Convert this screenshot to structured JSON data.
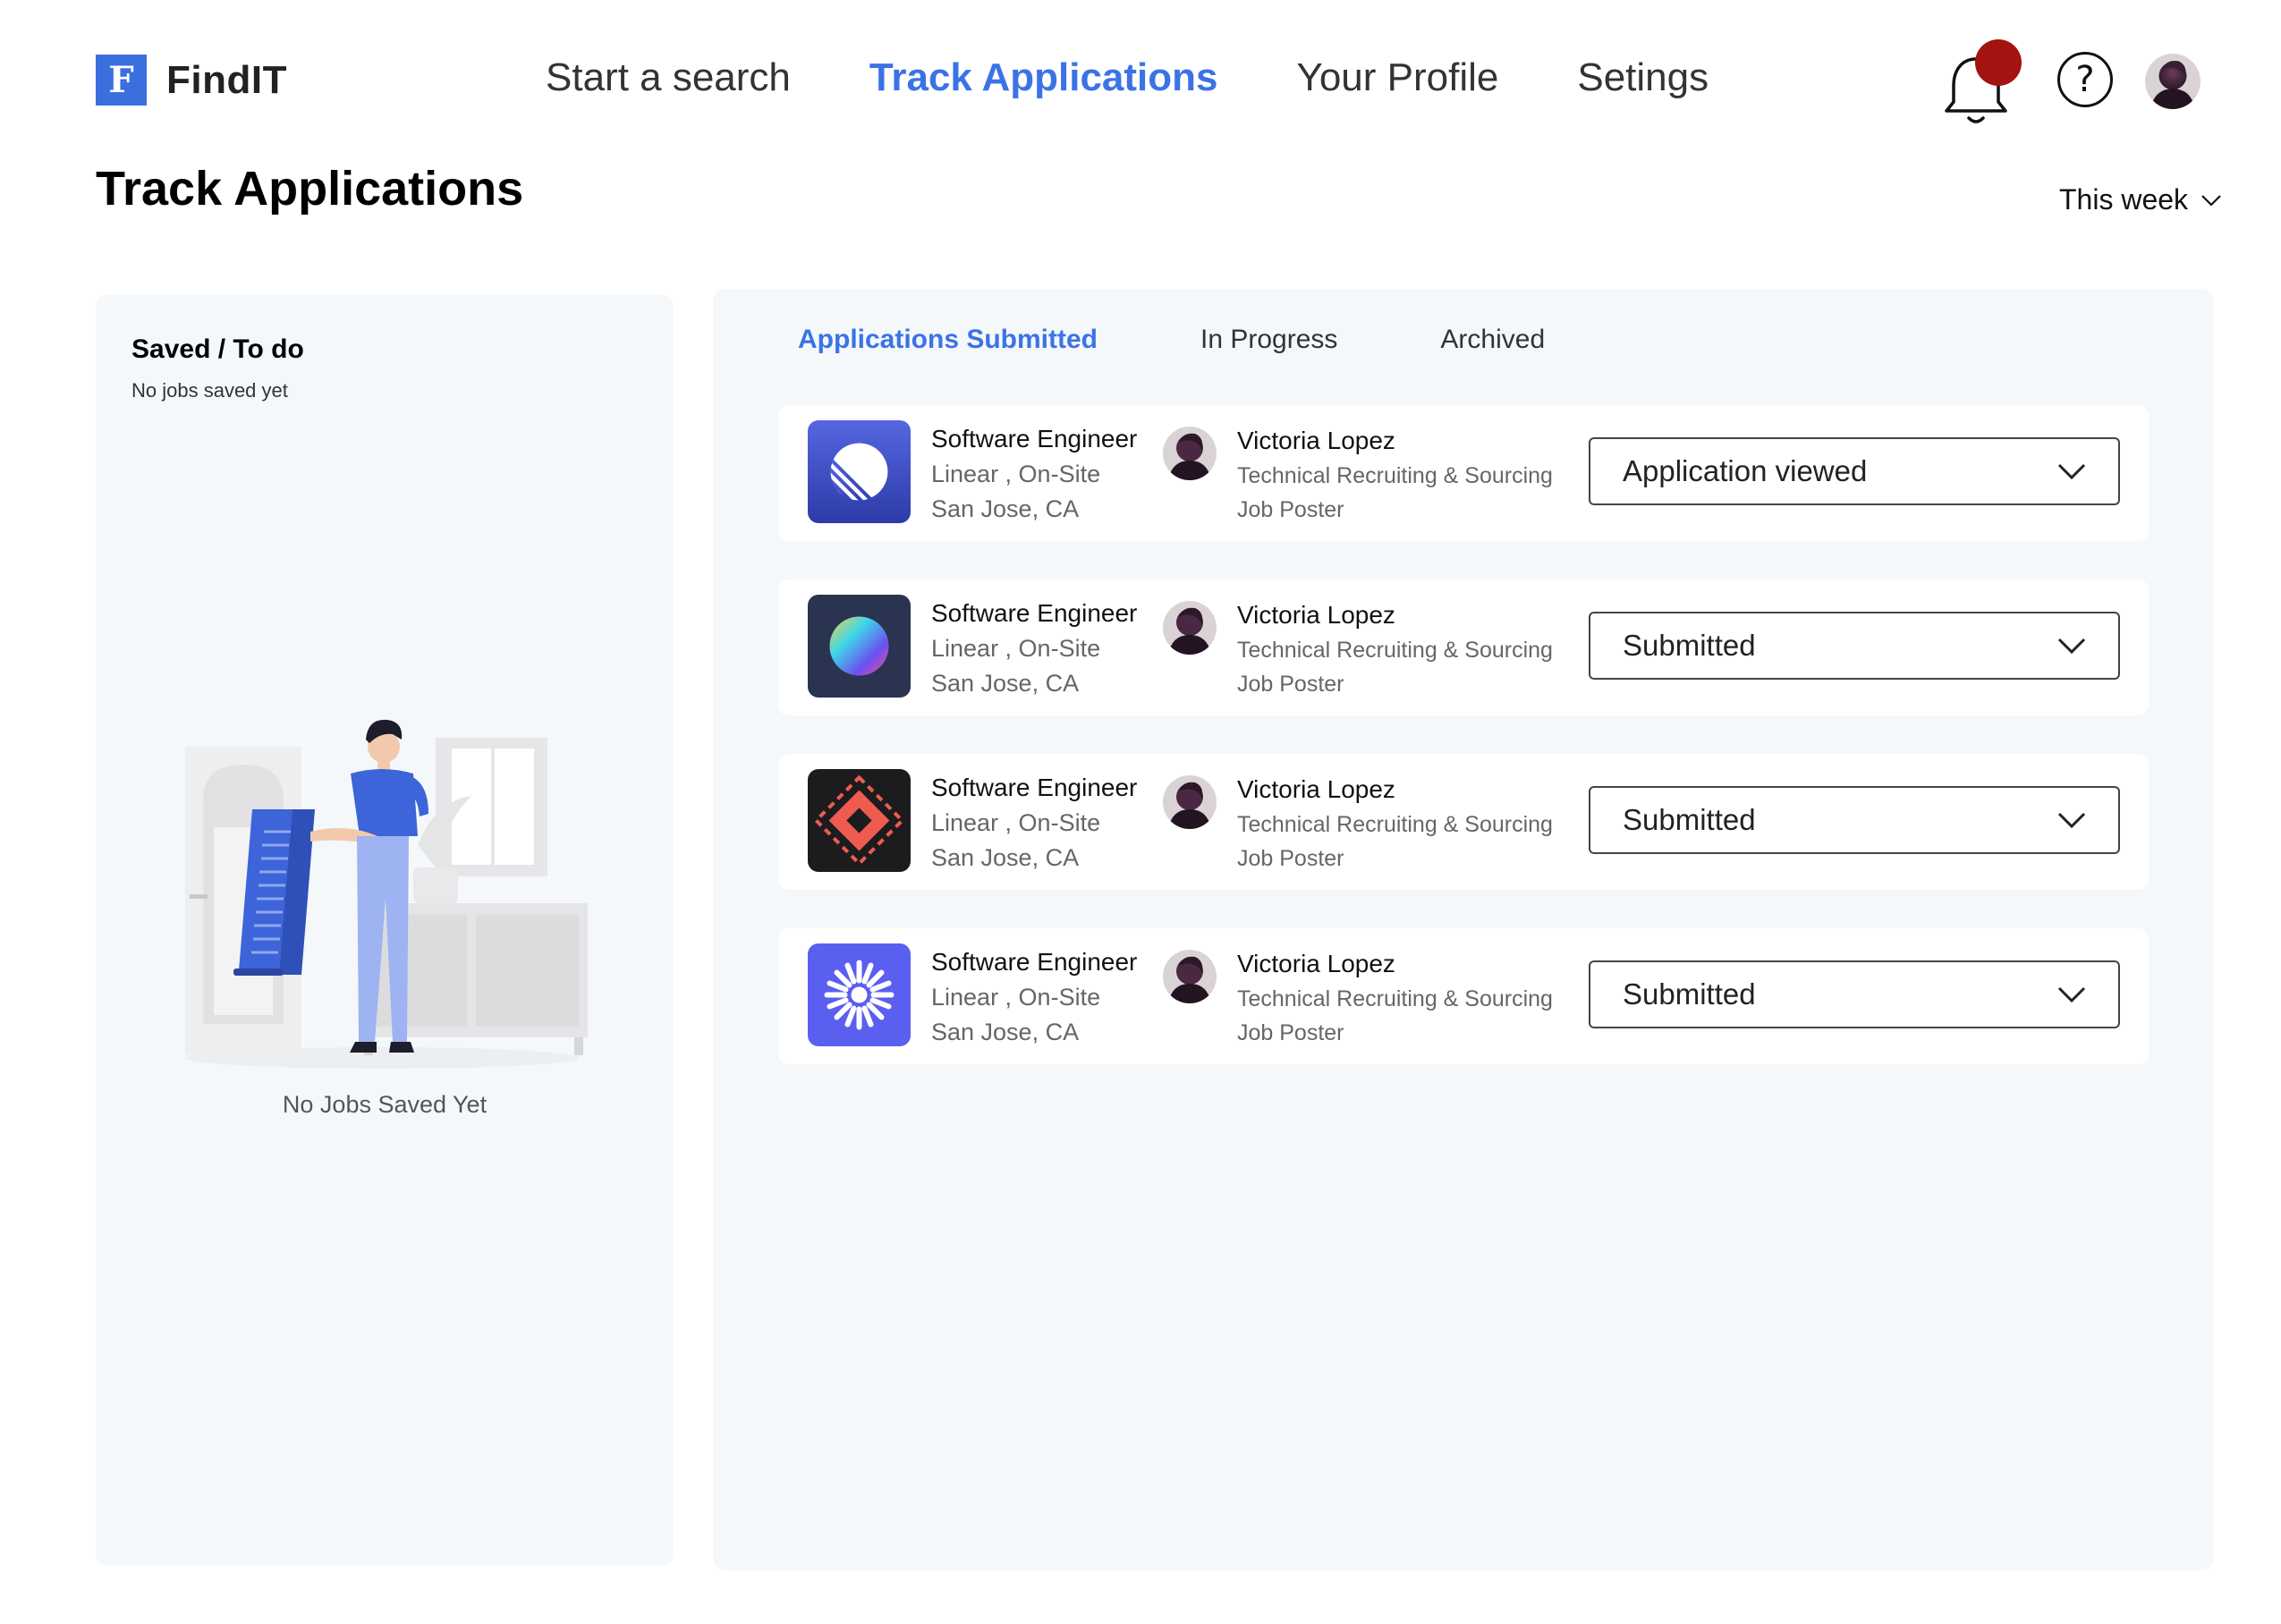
{
  "app": {
    "logo_letter": "F",
    "name": "FindIT"
  },
  "nav": [
    {
      "label": "Start a search",
      "active": false
    },
    {
      "label": "Track Applications",
      "active": true
    },
    {
      "label": "Your Profile",
      "active": false
    },
    {
      "label": "Setings",
      "active": false
    }
  ],
  "header_icons": {
    "notification": "bell-icon",
    "help": "question-icon",
    "help_glyph": "?",
    "user": "user-avatar"
  },
  "page": {
    "title": "Track Applications",
    "period_filter": "This week"
  },
  "saved_panel": {
    "title": "Saved / To do",
    "subtitle": "No jobs saved yet",
    "empty_state": "No Jobs Saved Yet"
  },
  "tabs": [
    {
      "label": "Applications Submitted",
      "active": true
    },
    {
      "label": "In Progress",
      "active": false
    },
    {
      "label": "Archived",
      "active": false
    }
  ],
  "applications": [
    {
      "logo": "linear-logo",
      "title": "Software Engineer",
      "company_mode": "Linear , On-Site",
      "location": "San Jose, CA",
      "poster_name": "Victoria Lopez",
      "poster_team": "Technical Recruiting & Sourcing",
      "poster_role": "Job Poster",
      "status": "Application viewed"
    },
    {
      "logo": "gradient-orb-logo",
      "title": "Software Engineer",
      "company_mode": "Linear , On-Site",
      "location": "San Jose, CA",
      "poster_name": "Victoria Lopez",
      "poster_team": "Technical Recruiting & Sourcing",
      "poster_role": "Job Poster",
      "status": "Submitted"
    },
    {
      "logo": "red-diamond-logo",
      "title": "Software Engineer",
      "company_mode": "Linear , On-Site",
      "location": "San Jose, CA",
      "poster_name": "Victoria Lopez",
      "poster_team": "Technical Recruiting & Sourcing",
      "poster_role": "Job Poster",
      "status": "Submitted"
    },
    {
      "logo": "starburst-logo",
      "title": "Software Engineer",
      "company_mode": "Linear , On-Site",
      "location": "San Jose, CA",
      "poster_name": "Victoria Lopez",
      "poster_team": "Technical Recruiting & Sourcing",
      "poster_role": "Job Poster",
      "status": "Submitted"
    }
  ],
  "colors": {
    "accent": "#3b73e6",
    "notification_dot": "#a3130f",
    "panel_bg": "#f5f8fb"
  }
}
